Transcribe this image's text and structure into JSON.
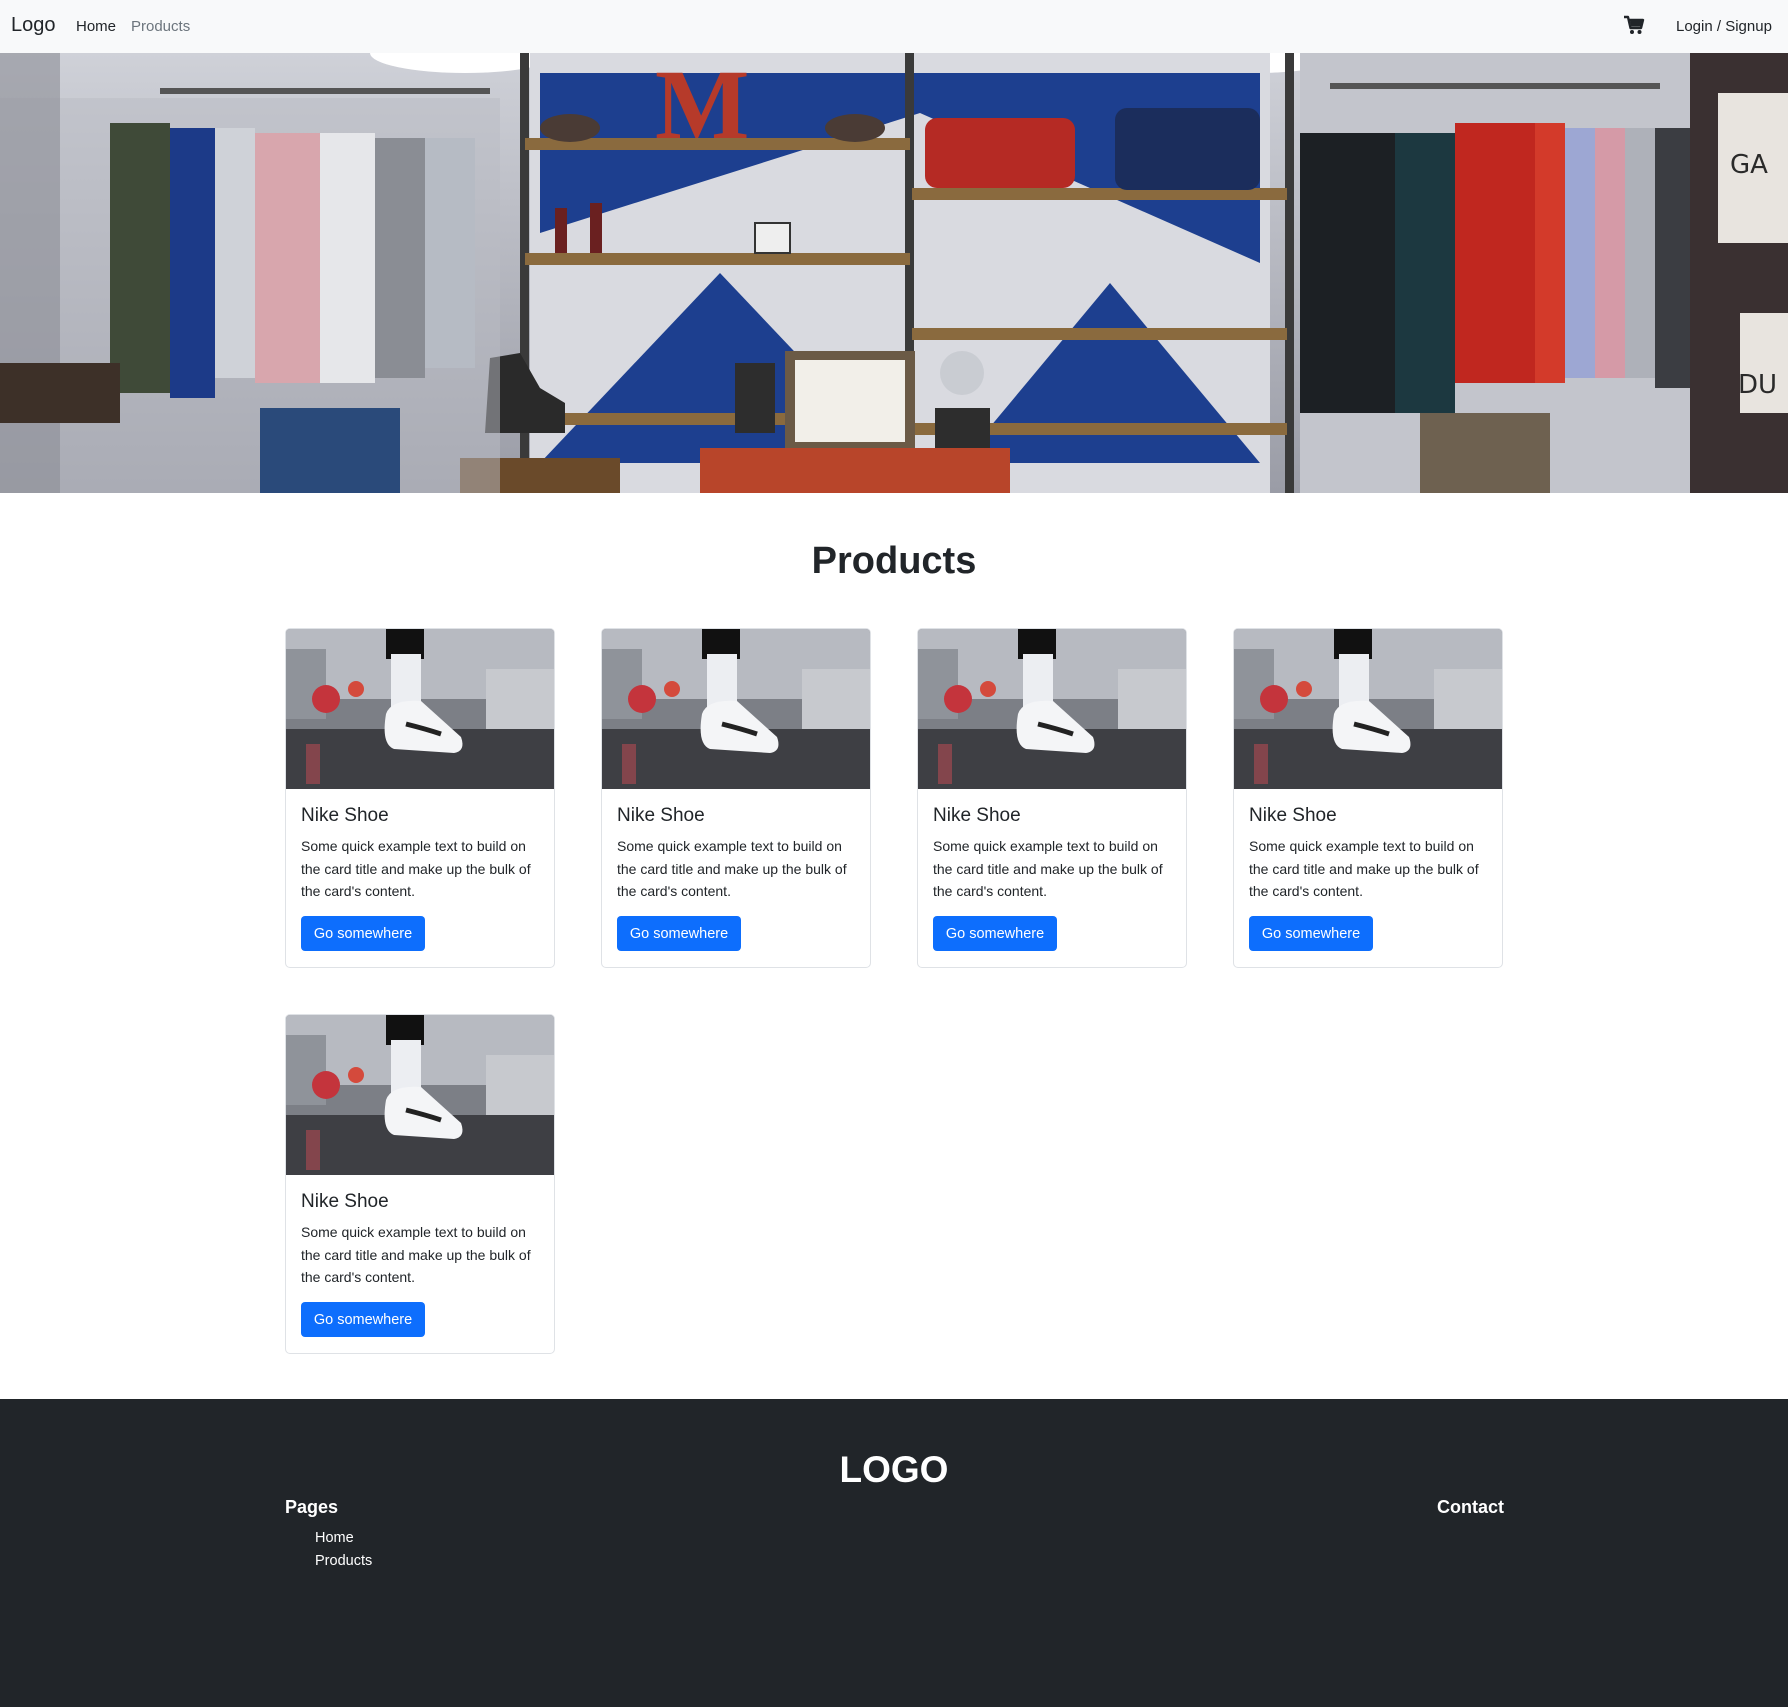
{
  "navbar": {
    "brand": "Logo",
    "links": [
      {
        "label": "Home"
      },
      {
        "label": "Products"
      }
    ],
    "cart_icon": "cart-icon",
    "login_label": "Login / Signup"
  },
  "hero": {
    "image": "clothing-store-interior-photo"
  },
  "products": {
    "title": "Products",
    "cards": [
      {
        "image": "sneaker-photo",
        "title": "Nike Shoe",
        "text": "Some quick example text to build on the card title and make up the bulk of the card's content.",
        "button": "Go somewhere"
      },
      {
        "image": "sneaker-photo",
        "title": "Nike Shoe",
        "text": "Some quick example text to build on the card title and make up the bulk of the card's content.",
        "button": "Go somewhere"
      },
      {
        "image": "sneaker-photo",
        "title": "Nike Shoe",
        "text": "Some quick example text to build on the card title and make up the bulk of the card's content.",
        "button": "Go somewhere"
      },
      {
        "image": "sneaker-photo",
        "title": "Nike Shoe",
        "text": "Some quick example text to build on the card title and make up the bulk of the card's content.",
        "button": "Go somewhere"
      },
      {
        "image": "sneaker-photo",
        "title": "Nike Shoe",
        "text": "Some quick example text to build on the card title and make up the bulk of the card's content.",
        "button": "Go somewhere"
      }
    ]
  },
  "footer": {
    "logo": "LOGO",
    "pages_heading": "Pages",
    "links": [
      {
        "label": "Home"
      },
      {
        "label": "Products"
      }
    ],
    "contact_heading": "Contact"
  },
  "colors": {
    "navbar_bg": "#f8f9fa",
    "primary_button": "#0d6efd",
    "footer_bg": "#212529"
  }
}
